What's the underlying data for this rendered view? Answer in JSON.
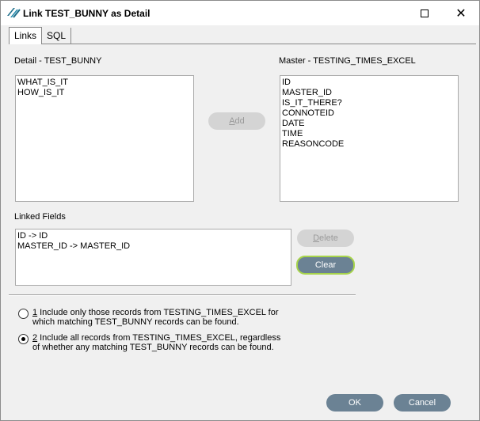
{
  "window": {
    "title": "Link TEST_BUNNY as Detail",
    "maximize_glyph": "□",
    "close_glyph": "✕"
  },
  "tabs": [
    {
      "label": "Links",
      "active": true
    },
    {
      "label": "SQL",
      "active": false
    }
  ],
  "detail": {
    "label": "Detail - TEST_BUNNY",
    "items": [
      "WHAT_IS_IT",
      "HOW_IS_IT"
    ]
  },
  "master": {
    "label": "Master - TESTING_TIMES_EXCEL",
    "items": [
      "ID",
      "MASTER_ID",
      "IS_IT_THERE?",
      "CONNOTEID",
      "DATE",
      "TIME",
      "REASONCODE"
    ]
  },
  "add_button": {
    "label_first": "A",
    "label_rest": "dd"
  },
  "linked": {
    "label": "Linked Fields",
    "items": [
      "ID -> ID",
      "MASTER_ID -> MASTER_ID"
    ]
  },
  "delete_button": {
    "label_first": "D",
    "label_rest": "elete"
  },
  "clear_button": {
    "label": "Clear"
  },
  "options": [
    {
      "number": "1",
      "text": "Include only those records from TESTING_TIMES_EXCEL for which matching TEST_BUNNY records can be found.",
      "checked": false
    },
    {
      "number": "2",
      "text": "Include all records from TESTING_TIMES_EXCEL, regardless of whether any matching TEST_BUNNY records can be found.",
      "checked": true
    }
  ],
  "ok_button": {
    "label": "OK"
  },
  "cancel_button": {
    "label": "Cancel"
  },
  "colors": {
    "button": "#6b8294",
    "button_disabled": "#d4d4d4",
    "focus_ring": "#a7d44a"
  }
}
